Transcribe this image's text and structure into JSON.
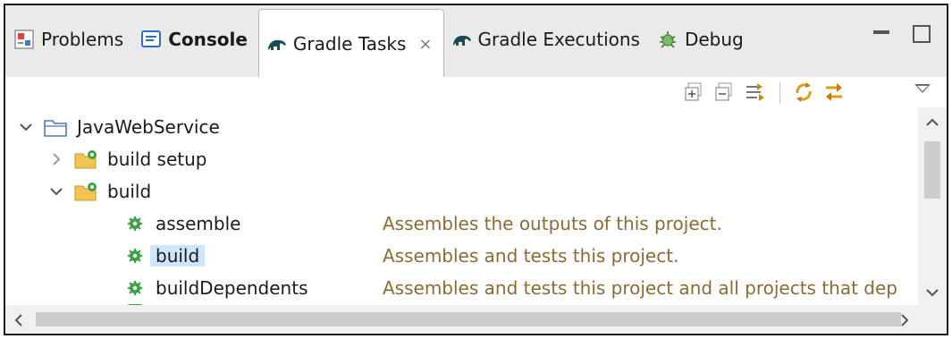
{
  "tabs": [
    {
      "label": "Problems",
      "bold": false,
      "icon": "problems-icon"
    },
    {
      "label": "Console",
      "bold": true,
      "icon": "console-icon"
    },
    {
      "label": "Gradle Tasks",
      "bold": false,
      "icon": "gradle-elephant-icon",
      "active": true,
      "close": "×"
    },
    {
      "label": "Gradle Executions",
      "bold": false,
      "icon": "gradle-elephant-icon"
    },
    {
      "label": "Debug",
      "bold": false,
      "icon": "debug-icon"
    }
  ],
  "tree": {
    "project": "JavaWebService",
    "groups": [
      {
        "label": "build setup",
        "expanded": false
      },
      {
        "label": "build",
        "expanded": true
      }
    ],
    "tasks": [
      {
        "label": "assemble",
        "desc": "Assembles the outputs of this project.",
        "selected": false
      },
      {
        "label": "build",
        "desc": "Assembles and tests this project.",
        "selected": true
      },
      {
        "label": "buildDependents",
        "desc": "Assembles and tests this project and all projects that dep",
        "selected": false
      }
    ]
  },
  "colors": {
    "accent_green": "#3fa24a",
    "description": "#8b6b34",
    "selection": "#cfe5fb",
    "folder": "#e8b84a"
  }
}
